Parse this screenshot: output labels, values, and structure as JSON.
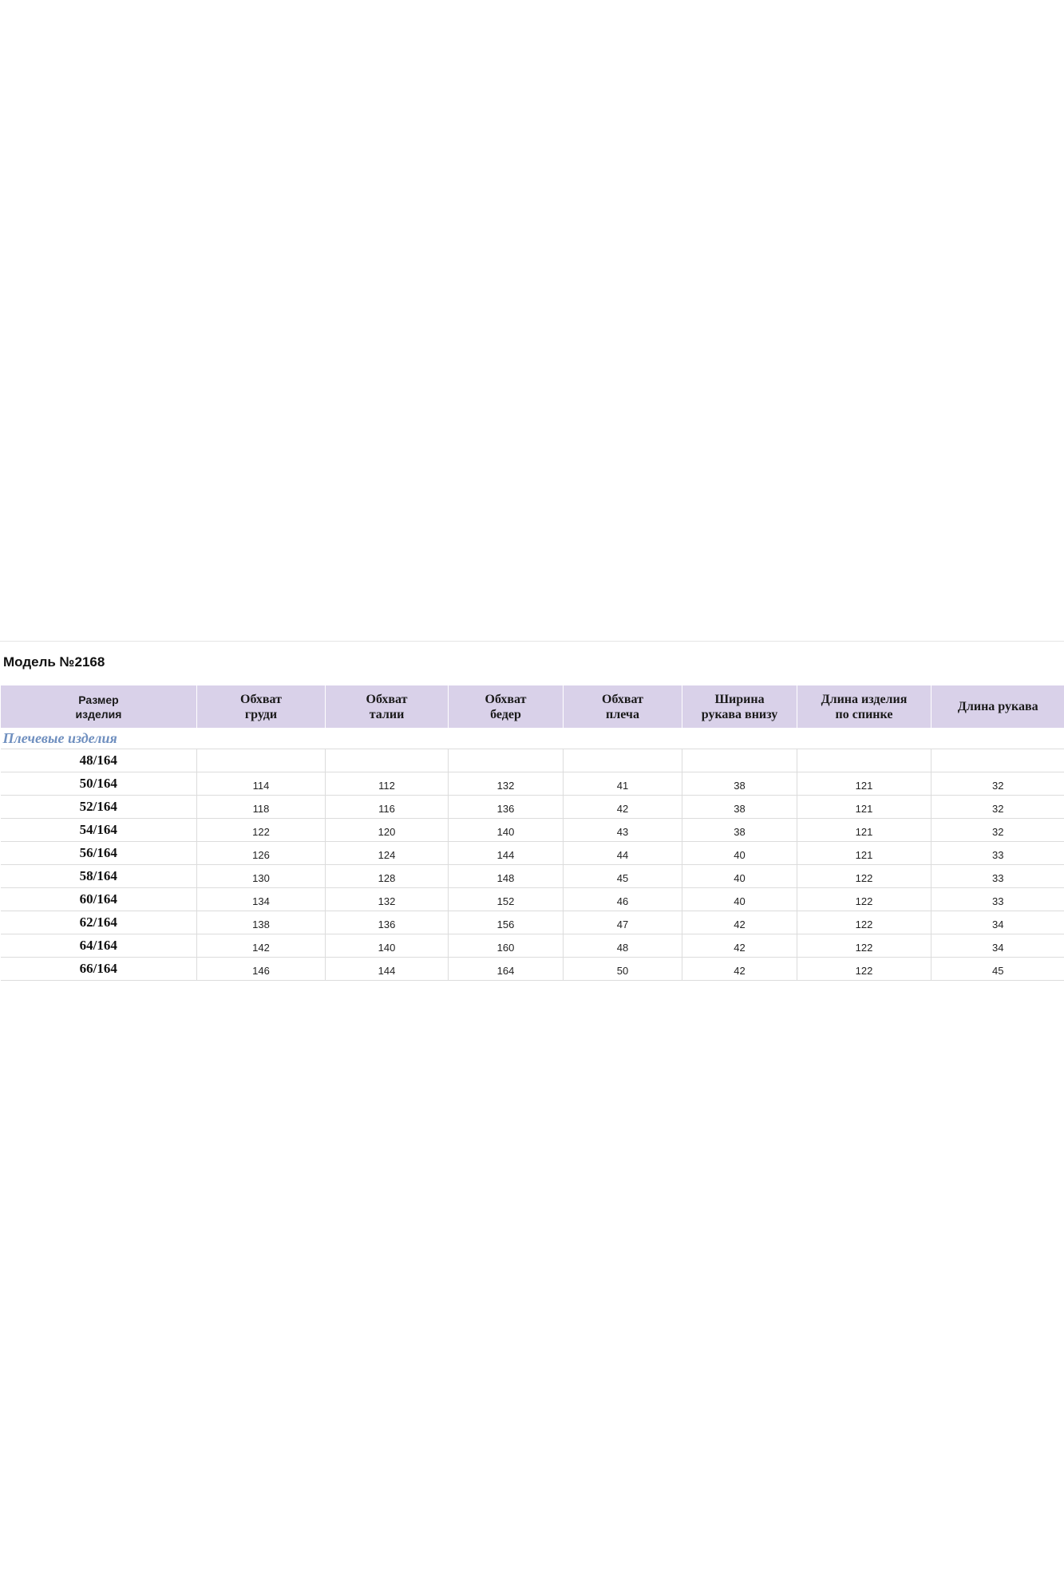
{
  "title": "Модель №2168",
  "section": "Плечевые изделия",
  "columns": [
    "Размер\nизделия",
    "Обхват\nгруди",
    "Обхват\nталии",
    "Обхват\nбедер",
    "Обхват\nплеча",
    "Ширина\nрукава внизу",
    "Длина изделия\nпо спинке",
    "Длина рукава"
  ],
  "rows": [
    [
      "48/164",
      "",
      "",
      "",
      "",
      "",
      "",
      ""
    ],
    [
      "50/164",
      "114",
      "112",
      "132",
      "41",
      "38",
      "121",
      "32"
    ],
    [
      "52/164",
      "118",
      "116",
      "136",
      "42",
      "38",
      "121",
      "32"
    ],
    [
      "54/164",
      "122",
      "120",
      "140",
      "43",
      "38",
      "121",
      "32"
    ],
    [
      "56/164",
      "126",
      "124",
      "144",
      "44",
      "40",
      "121",
      "33"
    ],
    [
      "58/164",
      "130",
      "128",
      "148",
      "45",
      "40",
      "122",
      "33"
    ],
    [
      "60/164",
      "134",
      "132",
      "152",
      "46",
      "40",
      "122",
      "33"
    ],
    [
      "62/164",
      "138",
      "136",
      "156",
      "47",
      "42",
      "122",
      "34"
    ],
    [
      "64/164",
      "142",
      "140",
      "160",
      "48",
      "42",
      "122",
      "34"
    ],
    [
      "66/164",
      "146",
      "144",
      "164",
      "50",
      "42",
      "122",
      "45"
    ]
  ]
}
